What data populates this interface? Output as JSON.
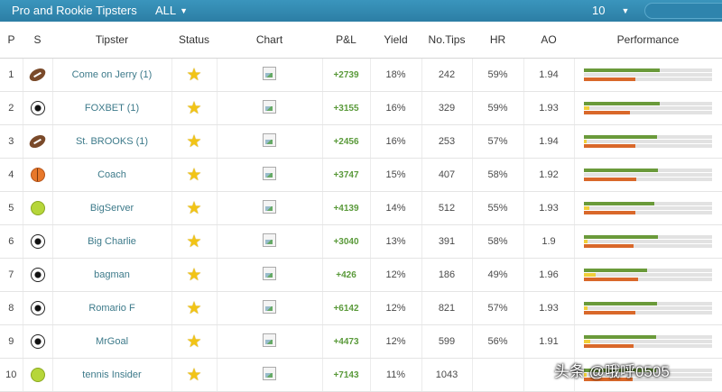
{
  "header": {
    "title": "Pro and Rookie Tipsters",
    "filter_value": "ALL",
    "per_page_value": "10"
  },
  "columns": [
    "P",
    "S",
    "Tipster",
    "Status",
    "Chart",
    "P&L",
    "Yield",
    "No.Tips",
    "HR",
    "AO",
    "Performance"
  ],
  "rows": [
    {
      "rank": "1",
      "sport": "american-football-icon",
      "tipster": "Come on Jerry (1)",
      "pl": "+2739",
      "yield": "18%",
      "tips": "242",
      "hr": "59%",
      "ao": "1.94",
      "perf": [
        0.59,
        0.0,
        0.4
      ]
    },
    {
      "rank": "2",
      "sport": "soccer-ball-icon",
      "tipster": "FOXBET (1)",
      "pl": "+3155",
      "yield": "16%",
      "tips": "329",
      "hr": "59%",
      "ao": "1.93",
      "perf": [
        0.59,
        0.04,
        0.36
      ]
    },
    {
      "rank": "3",
      "sport": "american-football-icon",
      "tipster": "St. BROOKS (1)",
      "pl": "+2456",
      "yield": "16%",
      "tips": "253",
      "hr": "57%",
      "ao": "1.94",
      "perf": [
        0.57,
        0.02,
        0.4
      ]
    },
    {
      "rank": "4",
      "sport": "basketball-icon",
      "tipster": "Coach",
      "pl": "+3747",
      "yield": "15%",
      "tips": "407",
      "hr": "58%",
      "ao": "1.92",
      "perf": [
        0.58,
        0.0,
        0.41
      ]
    },
    {
      "rank": "5",
      "sport": "tennis-ball-icon",
      "tipster": "BigServer",
      "pl": "+4139",
      "yield": "14%",
      "tips": "512",
      "hr": "55%",
      "ao": "1.93",
      "perf": [
        0.55,
        0.04,
        0.4
      ]
    },
    {
      "rank": "6",
      "sport": "soccer-ball-icon",
      "tipster": "Big Charlie",
      "pl": "+3040",
      "yield": "13%",
      "tips": "391",
      "hr": "58%",
      "ao": "1.9",
      "perf": [
        0.58,
        0.03,
        0.39
      ]
    },
    {
      "rank": "7",
      "sport": "soccer-ball-icon",
      "tipster": "bagman",
      "pl": "+426",
      "yield": "12%",
      "tips": "186",
      "hr": "49%",
      "ao": "1.96",
      "perf": [
        0.49,
        0.09,
        0.42
      ]
    },
    {
      "rank": "8",
      "sport": "soccer-ball-icon",
      "tipster": "Romario F",
      "pl": "+6142",
      "yield": "12%",
      "tips": "821",
      "hr": "57%",
      "ao": "1.93",
      "perf": [
        0.57,
        0.03,
        0.4
      ]
    },
    {
      "rank": "9",
      "sport": "soccer-ball-icon",
      "tipster": "MrGoal",
      "pl": "+4473",
      "yield": "12%",
      "tips": "599",
      "hr": "56%",
      "ao": "1.91",
      "perf": [
        0.56,
        0.05,
        0.39
      ]
    },
    {
      "rank": "10",
      "sport": "tennis-ball-icon",
      "tipster": "tennis Insider",
      "pl": "+7143",
      "yield": "11%",
      "tips": "1043",
      "hr": "",
      "ao": "",
      "perf": [
        0.56,
        0.02,
        0.38
      ]
    }
  ],
  "watermark": "头条 @哦呼0505",
  "colors": {
    "win": "#6a9a3a",
    "void": "#f0cf3a",
    "loss": "#d9682a",
    "header_bg": "#2c7ea5"
  }
}
